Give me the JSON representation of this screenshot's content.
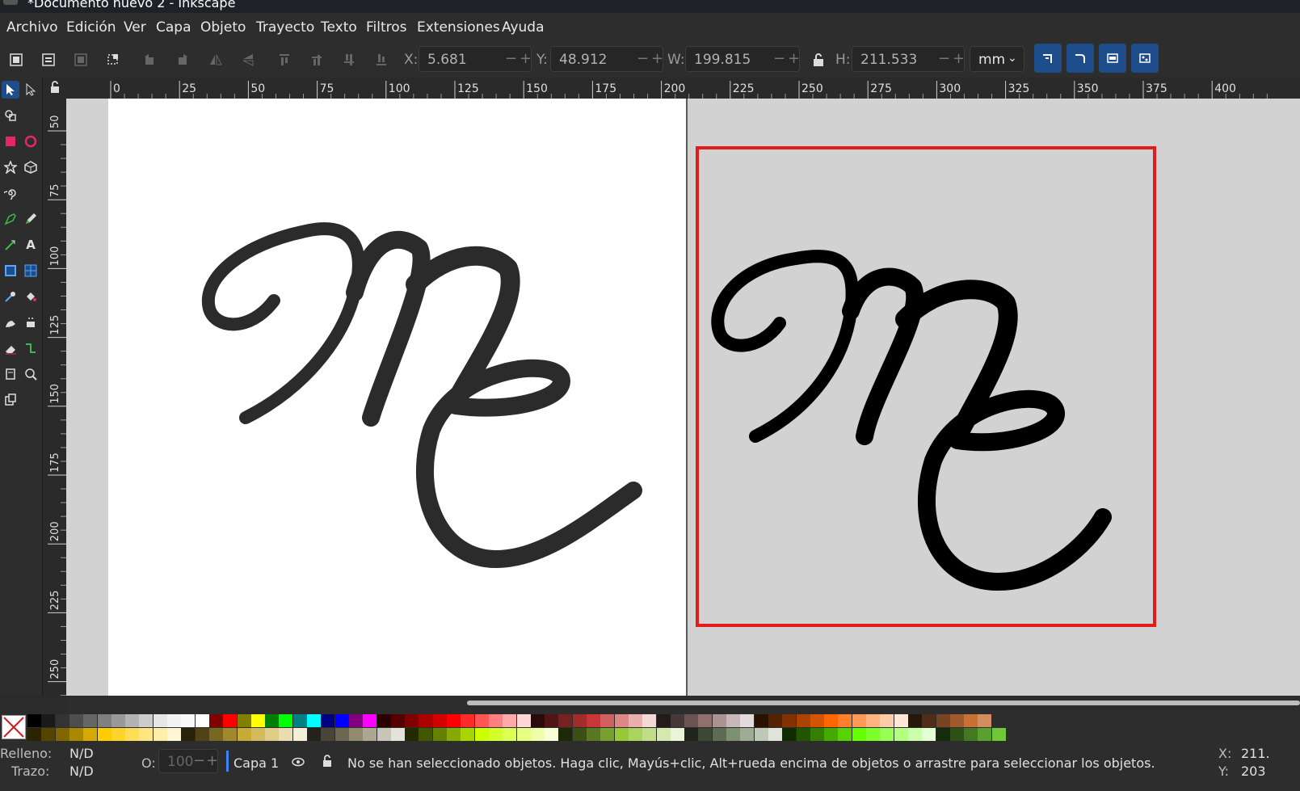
{
  "window": {
    "title": "*Documento nuevo 2 - Inkscape"
  },
  "menu": [
    "Archivo",
    "Edición",
    "Ver",
    "Capa",
    "Objeto",
    "Trayecto",
    "Texto",
    "Filtros",
    "Extensiones",
    "Ayuda"
  ],
  "toolbar": {
    "x_label": "X:",
    "x_value": "5.681",
    "y_label": "Y:",
    "y_value": "48.912",
    "w_label": "W:",
    "w_value": "199.815",
    "h_label": "H:",
    "h_value": "211.533",
    "unit": "mm",
    "accent": "#1d4d8b",
    "icons": [
      "select-all-icon",
      "select-all-layers-icon",
      "deselect-icon",
      "select-same-icon",
      "rotate-ccw-icon",
      "rotate-cw-icon",
      "flip-horizontal-icon",
      "flip-vertical-icon",
      "raise-to-top-icon",
      "raise-icon",
      "lower-icon",
      "lower-to-bottom-icon",
      "lock-ratio-icon",
      "scale-stroke-icon",
      "scale-corners-icon",
      "move-gradients-icon",
      "move-patterns-icon"
    ]
  },
  "tools": [
    "selector-icon",
    "node-icon",
    "tweak-icon",
    "rectangle-icon",
    "ellipse-icon",
    "star-icon",
    "box3d-icon",
    "spiral-icon",
    "pen-icon",
    "pencil-icon",
    "calligraphy-icon",
    "text-icon",
    "gradient-icon",
    "mesh-icon",
    "dropper-icon",
    "paint-bucket-icon",
    "spray-icon",
    "eraser-icon",
    "connector-icon",
    "measure-icon",
    "zoom-icon",
    "pages-icon",
    "clone-icon"
  ],
  "rulers": {
    "horizontal": [
      "0",
      "25",
      "50",
      "75",
      "100",
      "125",
      "150",
      "175",
      "200",
      "225",
      "250",
      "275",
      "300",
      "325",
      "350",
      "375",
      "400"
    ],
    "vertical": [
      "50",
      "75",
      "100",
      "125",
      "150",
      "175",
      "200",
      "225",
      "250"
    ]
  },
  "canvas": {
    "left_monogram": "ME",
    "right_monogram": "ME",
    "selection_color": "#e21b1b",
    "page_color": "#ffffff",
    "desk_color": "#d2d2d2"
  },
  "palette": {
    "none_label": "X",
    "row1": [
      "#000000",
      "#1a1a1a",
      "#333333",
      "#4d4d4d",
      "#666666",
      "#808080",
      "#999999",
      "#b3b3b3",
      "#cccccc",
      "#e6e6e6",
      "#f2f2f2",
      "#f9f9f9",
      "#ffffff",
      "#800000",
      "#ff0000",
      "#808000",
      "#ffff00",
      "#008000",
      "#00ff00",
      "#008080",
      "#00ffff",
      "#000080",
      "#0000ff",
      "#800080",
      "#ff00ff",
      "#2b0000",
      "#550000",
      "#800000",
      "#aa0000",
      "#d40000",
      "#ff0000",
      "#ff2a2a",
      "#ff5555",
      "#ff8080",
      "#ffaaaa",
      "#ffd5d5",
      "#280b0b",
      "#501616",
      "#782121",
      "#a02c2c",
      "#c83737",
      "#d35f5f",
      "#de8787",
      "#e9afaf",
      "#f4d7d7",
      "#241c1c",
      "#483737",
      "#6c5353",
      "#916f6f",
      "#ac9393",
      "#c8b7b7",
      "#e3dbdb",
      "#2b1100",
      "#552200",
      "#803300",
      "#aa4400",
      "#d45500",
      "#ff6600",
      "#ff7f2a",
      "#ff9955",
      "#ffb380",
      "#ffccaa",
      "#ffe6d5",
      "#28170b",
      "#502d16",
      "#784421",
      "#a05a2c",
      "#c87137",
      "#d38d5f"
    ],
    "row2": [
      "#2b2200",
      "#554400",
      "#806600",
      "#aa8800",
      "#d4aa00",
      "#ffcc00",
      "#ffd42a",
      "#ffdd55",
      "#ffe680",
      "#ffeeaa",
      "#fff6d5",
      "#28220b",
      "#504416",
      "#786721",
      "#a0892c",
      "#c8ab37",
      "#d3bc5f",
      "#decd87",
      "#e9ddaf",
      "#f4eed7",
      "#24221c",
      "#484537",
      "#6c6753",
      "#918a6f",
      "#aca793",
      "#c8c4b7",
      "#e3e2db",
      "#222b00",
      "#445500",
      "#668000",
      "#88aa00",
      "#aad400",
      "#ccff00",
      "#d4ff2a",
      "#ddff55",
      "#e5ff80",
      "#eeffaa",
      "#f6ffd5",
      "#1e280b",
      "#3c5016",
      "#5a7821",
      "#78a02c",
      "#96c837",
      "#abd35f",
      "#c0de87",
      "#d5e9af",
      "#eaf4d7",
      "#1f241c",
      "#3e4837",
      "#5d6c53",
      "#7c916f",
      "#9dac93",
      "#bec8b7",
      "#dee3db",
      "#112b00",
      "#225500",
      "#338000",
      "#44aa00",
      "#55d400",
      "#66ff00",
      "#7fff2a",
      "#99ff55",
      "#b3ff80",
      "#ccffaa",
      "#e5ffd5",
      "#162b0b",
      "#2d5016",
      "#447821",
      "#5aa02c",
      "#71c837"
    ]
  },
  "status": {
    "fill_label": "Relleno:",
    "fill_value": "N/D",
    "stroke_label": "Trazo:",
    "stroke_value": "N/D",
    "opacity_label": "O:",
    "opacity_value": "100",
    "layer": "Capa 1",
    "message": "No se han seleccionado objetos. Haga clic, Mayús+clic, Alt+rueda encima de objetos o arrastre para seleccionar los objetos.",
    "cursor_x_label": "X:",
    "cursor_x": "211.",
    "cursor_y_label": "Y:",
    "cursor_y": "203"
  }
}
